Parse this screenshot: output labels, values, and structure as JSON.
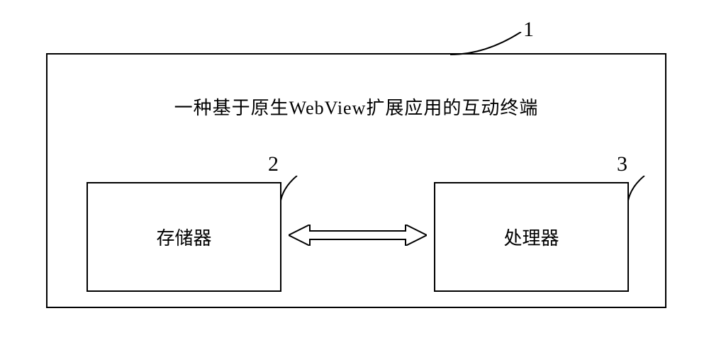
{
  "diagram": {
    "title": "一种基于原生WebView扩展应用的互动终端",
    "box_left": "存储器",
    "box_right": "处理器",
    "labels": {
      "outer": "1",
      "left_box": "2",
      "right_box": "3"
    }
  }
}
